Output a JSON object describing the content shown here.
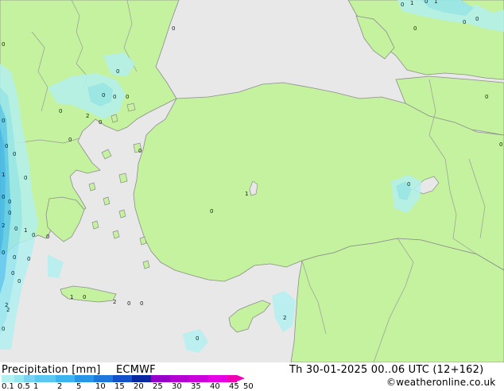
{
  "legend": {
    "title": "Precipitation [mm]",
    "model": "ECMWF",
    "labels": [
      "0.1",
      "0.5",
      "1",
      "2",
      "5",
      "10",
      "15",
      "20",
      "25",
      "30",
      "35",
      "40",
      "45",
      "50"
    ],
    "colors": [
      "#b4f0f0",
      "#96e6f0",
      "#78d2f0",
      "#5ac8f0",
      "#3cb4f0",
      "#2896e6",
      "#1e78dc",
      "#1450c8",
      "#0a28a0",
      "#9600c8",
      "#b400d2",
      "#cc00dc",
      "#e600e6",
      "#f000b4"
    ]
  },
  "header": {
    "valid_time": "Th 30-01-2025 00..06 UTC (12+162)",
    "credit": "©weatheronline.co.uk"
  },
  "map": {
    "land_color": "#c4f29e",
    "sea_color": "#e8e8e8",
    "border_color": "#9a9a9a",
    "marks": [
      "0",
      "1",
      "0",
      "1",
      "0",
      "0",
      "0",
      "0",
      "0",
      "0",
      "0",
      "0",
      "0",
      "0",
      "0",
      "0",
      "0",
      "0",
      "0",
      "0",
      "1",
      "0",
      "0",
      "1",
      "0",
      "0",
      "0",
      "0",
      "0",
      "0",
      "2",
      "0",
      "1",
      "0",
      "2",
      "0",
      "0",
      "2",
      "0",
      "0",
      "2",
      "1",
      "0",
      "0",
      "0",
      "0",
      "0",
      "0",
      "2",
      "0",
      "2"
    ]
  }
}
